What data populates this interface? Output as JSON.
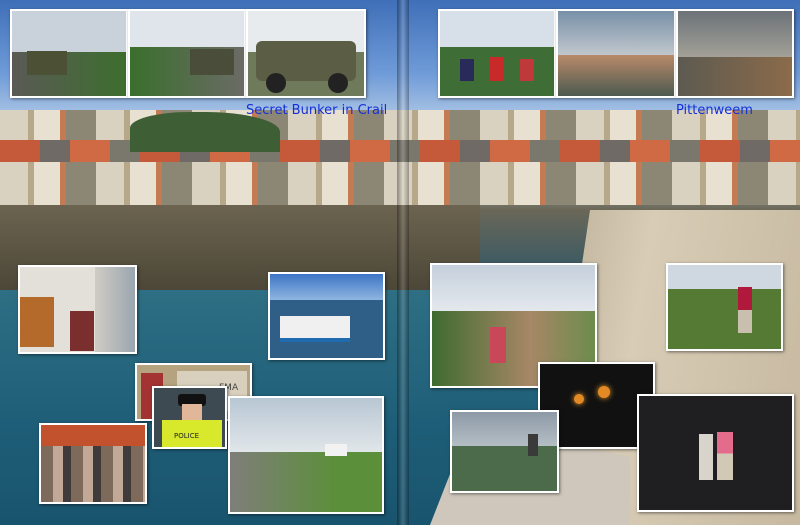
{
  "captions": {
    "left": "Secret Bunker in Crail",
    "right": "Pittenweem"
  },
  "signs": {
    "fma": "FMA",
    "police": "POLICE"
  },
  "colors": {
    "caption": "#1530d8",
    "photo_border": "#ffffff",
    "sky": "#3f6fb8",
    "water": "#1d5f7a"
  }
}
